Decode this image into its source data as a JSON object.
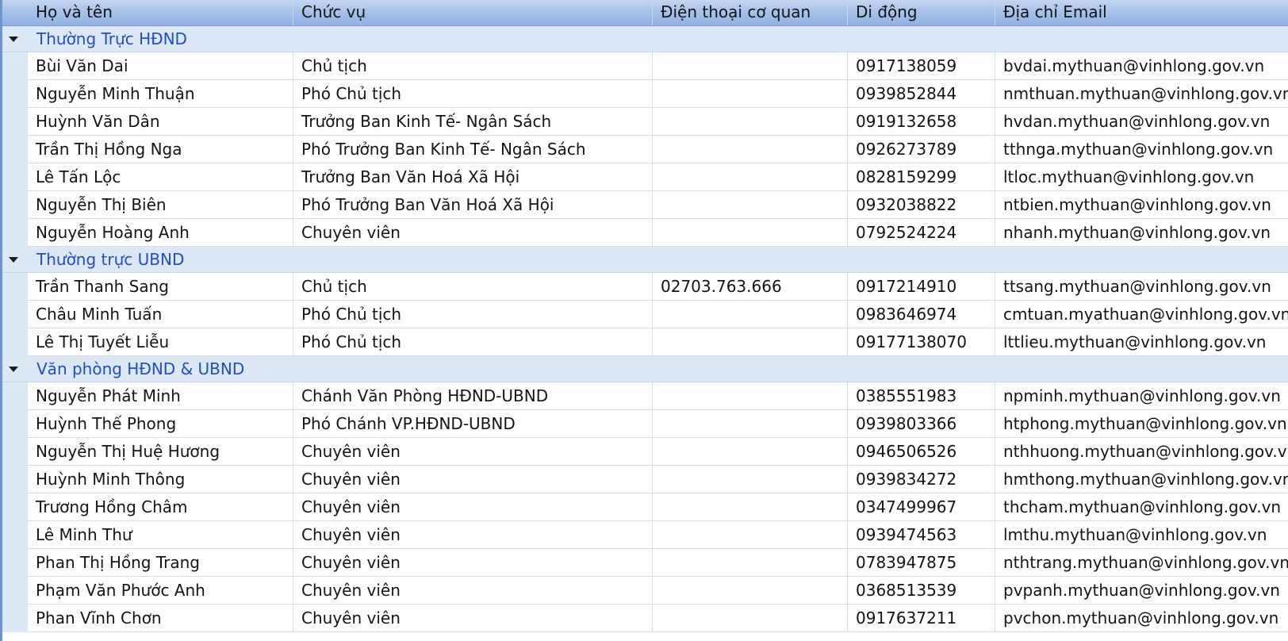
{
  "columns": {
    "name": "Họ và tên",
    "position": "Chức vụ",
    "office_phone": "Điện thoại cơ quan",
    "mobile": "Di động",
    "email": "Địa chỉ Email"
  },
  "groups": [
    {
      "label": "Thường Trực HĐND",
      "rows": [
        {
          "name": "Bùi Văn Dai",
          "position": "Chủ tịch",
          "office_phone": "",
          "mobile": "0917138059",
          "email": "bvdai.mythuan@vinhlong.gov.vn"
        },
        {
          "name": "Nguyễn Minh Thuận",
          "position": "Phó Chủ tịch",
          "office_phone": "",
          "mobile": "0939852844",
          "email": "nmthuan.mythuan@vinhlong.gov.vn"
        },
        {
          "name": "Huỳnh Văn Dân",
          "position": "Trưởng Ban Kinh Tế- Ngân Sách",
          "office_phone": "",
          "mobile": "0919132658",
          "email": "hvdan.mythuan@vinhlong.gov.vn"
        },
        {
          "name": "Trần Thị Hồng Nga",
          "position": "Phó Trưởng Ban Kinh Tế- Ngân Sách",
          "office_phone": "",
          "mobile": "0926273789",
          "email": "tthnga.mythuan@vinhlong.gov.vn"
        },
        {
          "name": "Lê Tấn Lộc",
          "position": "Trưởng Ban Văn Hoá Xã Hội",
          "office_phone": "",
          "mobile": "0828159299",
          "email": "ltloc.mythuan@vinhlong.gov.vn"
        },
        {
          "name": "Nguyễn Thị Biên",
          "position": "Phó Trưởng Ban Văn Hoá Xã Hội",
          "office_phone": "",
          "mobile": "0932038822",
          "email": "ntbien.mythuan@vinhlong.gov.vn"
        },
        {
          "name": "Nguyễn Hoàng Anh",
          "position": "Chuyên viên",
          "office_phone": "",
          "mobile": "0792524224",
          "email": "nhanh.mythuan@vinhlong.gov.vn"
        }
      ]
    },
    {
      "label": "Thường trực UBND",
      "rows": [
        {
          "name": "Trần Thanh Sang",
          "position": "Chủ tịch",
          "office_phone": "02703.763.666",
          "mobile": "0917214910",
          "email": "ttsang.mythuan@vinhlong.gov.vn"
        },
        {
          "name": "Châu Minh Tuấn",
          "position": "Phó Chủ tịch",
          "office_phone": "",
          "mobile": "0983646974",
          "email": "cmtuan.myathuan@vinhlong.gov.vn"
        },
        {
          "name": "Lê Thị Tuyết Liễu",
          "position": "Phó Chủ tịch",
          "office_phone": "",
          "mobile": "09177138070",
          "email": "lttlieu.mythuan@vinhlong.gov.vn"
        }
      ]
    },
    {
      "label": "Văn phòng HĐND & UBND",
      "rows": [
        {
          "name": "Nguyễn Phát Minh",
          "position": "Chánh Văn Phòng HĐND-UBND",
          "office_phone": "",
          "mobile": "0385551983",
          "email": "npminh.mythuan@vinhlong.gov.vn"
        },
        {
          "name": "Huỳnh Thế Phong",
          "position": "Phó Chánh VP.HĐND-UBND",
          "office_phone": "",
          "mobile": "0939803366",
          "email": "htphong.mythuan@vinhlong.gov.vn"
        },
        {
          "name": "Nguyễn Thị Huệ Hương",
          "position": "Chuyên viên",
          "office_phone": "",
          "mobile": "0946506526",
          "email": "nthhuong.mythuan@vinhlong.gov.vn"
        },
        {
          "name": "Huỳnh Minh Thông",
          "position": "Chuyên viên",
          "office_phone": "",
          "mobile": "0939834272",
          "email": "hmthong.mythuan@vinhlong.gov.vn"
        },
        {
          "name": "Trương Hồng Châm",
          "position": "Chuyên viên",
          "office_phone": "",
          "mobile": "0347499967",
          "email": "thcham.mythuan@vinhlong.gov.vn"
        },
        {
          "name": "Lê Minh Thư",
          "position": "Chuyên viên",
          "office_phone": "",
          "mobile": "0939474563",
          "email": "lmthu.mythuan@vinhlong.gov.vn"
        },
        {
          "name": "Phan Thị Hồng Trang",
          "position": "Chuyên viên",
          "office_phone": "",
          "mobile": "0783947875",
          "email": "nthtrang.mythuan@vinhlong.gov.vn"
        },
        {
          "name": "Phạm Văn Phước Anh",
          "position": "Chuyên viên",
          "office_phone": "",
          "mobile": "0368513539",
          "email": "pvpanh.mythuan@vinhlong.gov.vn"
        },
        {
          "name": "Phan Vĩnh Chơn",
          "position": "Chuyên viên",
          "office_phone": "",
          "mobile": "0917637211",
          "email": "pvchon.mythuan@vinhlong.gov.vn"
        }
      ]
    }
  ]
}
